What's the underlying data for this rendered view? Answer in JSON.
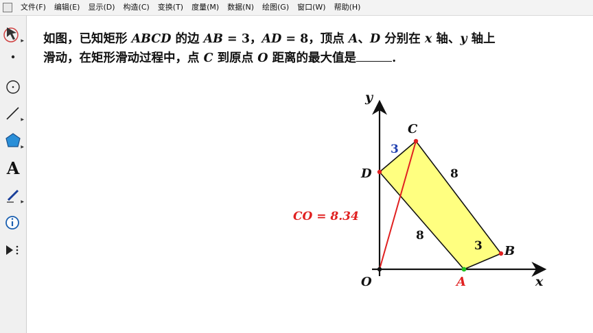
{
  "menu": {
    "items": [
      "文件(F)",
      "编辑(E)",
      "显示(D)",
      "构造(C)",
      "变换(T)",
      "度量(M)",
      "数据(N)",
      "绘图(G)",
      "窗口(W)",
      "帮助(H)"
    ]
  },
  "toolbar": {
    "text_tool_label": "A"
  },
  "problem": {
    "line1": {
      "a": "如图，已知矩形",
      "rect_name": "ABCD",
      "b": "的边",
      "ab_name": "AB",
      "ab_eq": " = 3，",
      "ad_name": "AD",
      "ad_eq": " = 8，顶点",
      "pa": "A",
      "sep": "、",
      "pd": "D",
      "c": "分别在",
      "x": "x",
      "d": "轴、",
      "y": "y",
      "e": "轴上"
    },
    "line2": {
      "a": "滑动，在矩形滑动过程中，点",
      "pc": "C",
      "b": "到原点",
      "po": "O",
      "c": "距离的最大值是",
      "end": "."
    }
  },
  "figure": {
    "axis_x_label": "x",
    "axis_y_label": "y",
    "origin_label": "O",
    "point_A": "A",
    "point_B": "B",
    "point_C": "C",
    "point_D": "D",
    "label_DC": "3",
    "label_CB": "8",
    "label_AB": "3",
    "label_AD": "8",
    "measurement_label": "CO = 8.34",
    "colors": {
      "rect_fill": "#ffff80",
      "segment_CO": "#e02020",
      "label_A": "#e02020",
      "label_DC": "#1f3fb0",
      "measurement": "#e02020",
      "point": "#e02020",
      "point_A": "#20c020",
      "axis": "#111111"
    }
  }
}
